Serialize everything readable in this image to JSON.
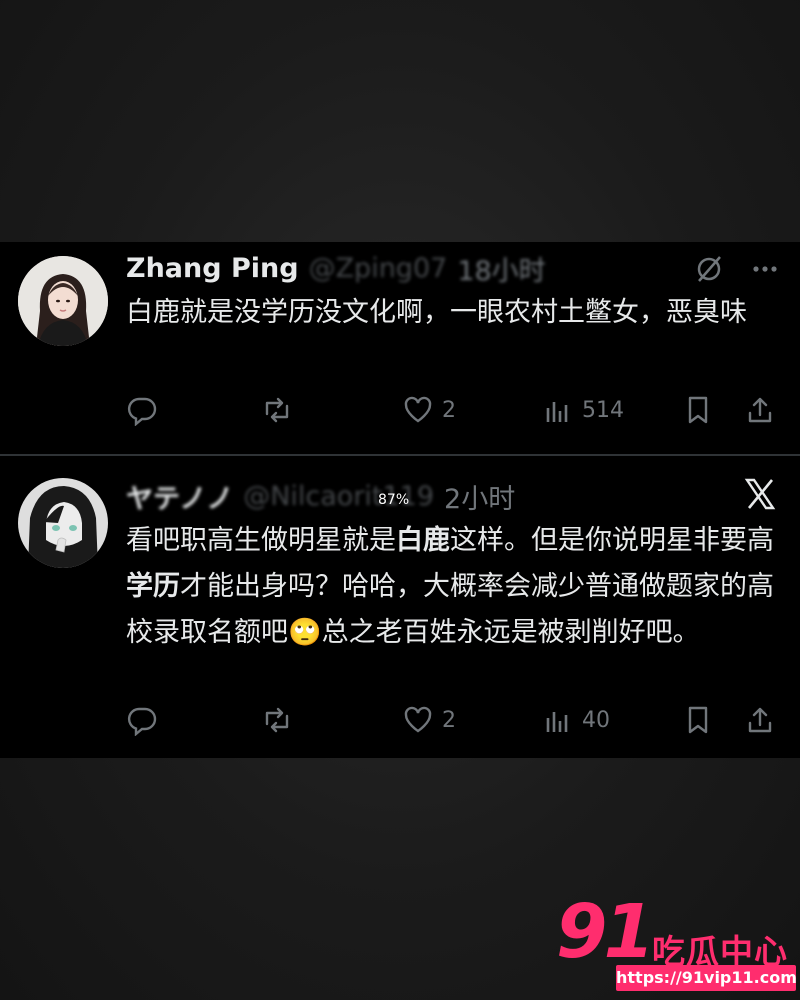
{
  "colors": {
    "background": "#1b1b1b",
    "panel": "#000000",
    "text": "#e7e9ea",
    "muted": "#71767b",
    "divider": "#2f3336",
    "brand": "#ff2d6e"
  },
  "tweets": [
    {
      "author": {
        "name": "Zhang Ping",
        "handle": "@Zping07",
        "avatar": "woman-portrait-avatar"
      },
      "time": "18小时",
      "body": "白鹿就是没学历没文化啊，一眼农村土鳖女，恶臭味",
      "actions": {
        "reply": "",
        "retweet": "",
        "likes": "2",
        "views": "514"
      }
    },
    {
      "author": {
        "name": "ヤテノノ",
        "handle": "@Nilcaorit119",
        "avatar": "anime-girl-avatar"
      },
      "time": "2小时",
      "body_parts": [
        "看吧职高生做明星就是",
        "白鹿",
        "这样。但是你说明星非要高",
        "学历",
        "才能出身吗？哈哈，大概率会减少普通做题家的高校录取名额吧",
        "总之老百姓永远是被剥削好吧。"
      ],
      "emoji": "🙄",
      "overlay_percent": "87%",
      "actions": {
        "reply": "",
        "retweet": "",
        "likes": "2",
        "views": "40"
      }
    }
  ],
  "watermark": {
    "number": "91",
    "title": "吃瓜中心",
    "url": "https://91vip11.com"
  }
}
